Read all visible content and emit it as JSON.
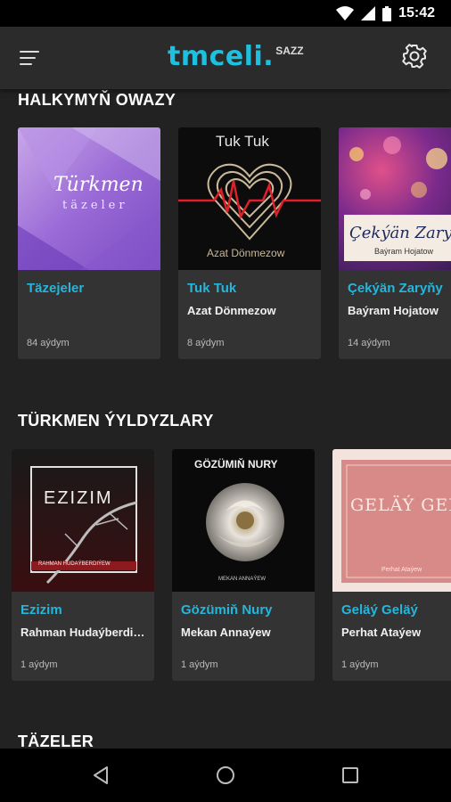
{
  "status_bar": {
    "time": "15:42",
    "icons": [
      "wifi-icon",
      "signal-icon",
      "battery-icon"
    ]
  },
  "app_bar": {
    "logo_main": "tmceli.",
    "logo_sub": "SAZZ",
    "menu_icon": "hamburger-menu-icon",
    "settings_icon": "gear-icon"
  },
  "sections": [
    {
      "title": "HALKYMYŇ OWAZY",
      "cards": [
        {
          "title": "Täzejeler",
          "artist": "",
          "count": "84 aýdym",
          "art_text": "Türkmen",
          "art_sub": "täzeler"
        },
        {
          "title": "Tuk Tuk",
          "artist": "Azat Dönmezow",
          "count": "8 aýdym",
          "art_text": "Tuk Tuk",
          "art_sub": "Azat Dönmezow"
        },
        {
          "title": "Çekýän Zaryňy",
          "artist": "Baýram Hojatow",
          "count": "14 aýdym",
          "art_text": "Çekýän Zaryňy",
          "art_sub": "Baýram Hojatow"
        }
      ]
    },
    {
      "title": "TÜRKMEN ÝYLDYZLARY",
      "cards": [
        {
          "title": "Ezizim",
          "artist": "Rahman Hudaýberdiýew",
          "count": "1 aýdym",
          "art_text": "EZIZIM",
          "art_sub": "RAHMAN HUDAÝBERDIÝEW"
        },
        {
          "title": "Gözümiň Nury",
          "artist": "Mekan Annaýew",
          "count": "1 aýdym",
          "art_text": "GÖZÜMIŇ NURY",
          "art_sub": "MEKAN ANNAÝEW"
        },
        {
          "title": "Geläý Geläý",
          "artist": "Perhat Ataýew",
          "count": "1 aýdym",
          "art_text": "GELÄÝ GELÄÝ",
          "art_sub": "Perhat Ataýew"
        }
      ]
    },
    {
      "title": "TÄZELER",
      "cards": []
    }
  ],
  "nav_bar": {
    "buttons": [
      "back-icon",
      "home-icon",
      "recents-icon"
    ]
  },
  "colors": {
    "accent": "#25b6dc",
    "background": "#222222",
    "card": "#333333",
    "app_bar": "#2b2b2b"
  }
}
